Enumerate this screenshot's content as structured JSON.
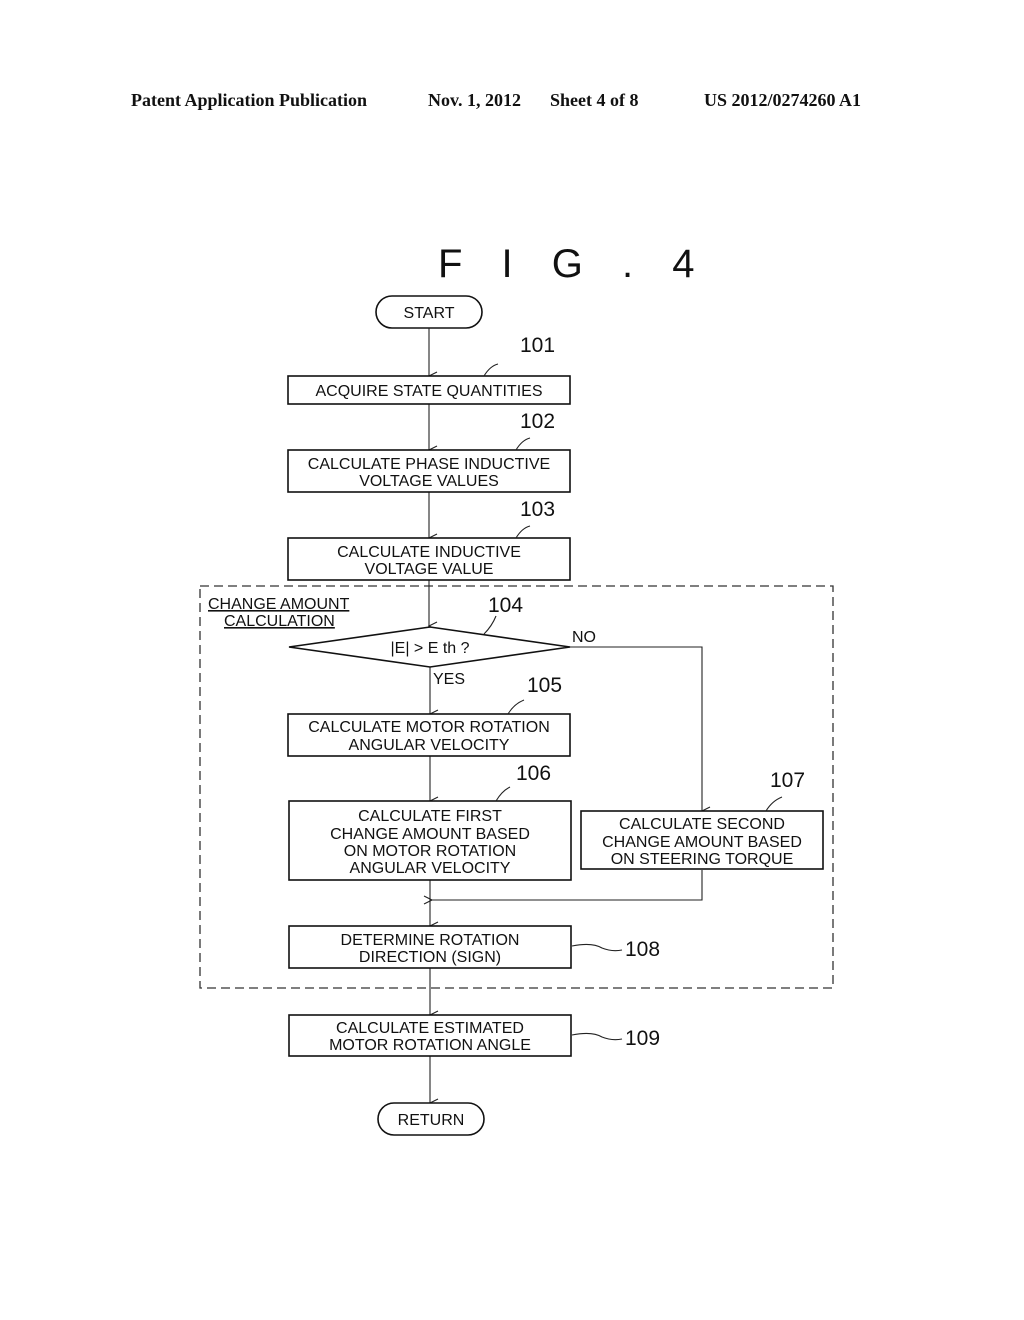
{
  "header": {
    "publication": "Patent Application Publication",
    "date": "Nov. 1, 2012",
    "sheet": "Sheet 4 of 8",
    "number": "US 2012/0274260 A1"
  },
  "figure": {
    "title": "F I G . 4"
  },
  "flowchart": {
    "start": "START",
    "end": "RETURN",
    "group_label": [
      "CHANGE AMOUNT",
      "CALCULATION"
    ],
    "steps": [
      {
        "ref": "101",
        "lines": [
          "ACQUIRE STATE QUANTITIES"
        ]
      },
      {
        "ref": "102",
        "lines": [
          "CALCULATE PHASE INDUCTIVE",
          "VOLTAGE VALUES"
        ]
      },
      {
        "ref": "103",
        "lines": [
          "CALCULATE INDUCTIVE",
          "VOLTAGE VALUE"
        ]
      },
      {
        "ref": "104",
        "lines": [
          "|E| > E th ?"
        ],
        "yes": "YES",
        "no": "NO"
      },
      {
        "ref": "105",
        "lines": [
          "CALCULATE MOTOR ROTATION",
          "ANGULAR VELOCITY"
        ]
      },
      {
        "ref": "106",
        "lines": [
          "CALCULATE FIRST",
          "CHANGE AMOUNT BASED",
          "ON MOTOR ROTATION",
          "ANGULAR VELOCITY"
        ]
      },
      {
        "ref": "107",
        "lines": [
          "CALCULATE SECOND",
          "CHANGE AMOUNT BASED",
          "ON STEERING TORQUE"
        ]
      },
      {
        "ref": "108",
        "lines": [
          "DETERMINE ROTATION",
          "DIRECTION (SIGN)"
        ]
      },
      {
        "ref": "109",
        "lines": [
          "CALCULATE ESTIMATED",
          "MOTOR ROTATION ANGLE"
        ]
      }
    ]
  }
}
